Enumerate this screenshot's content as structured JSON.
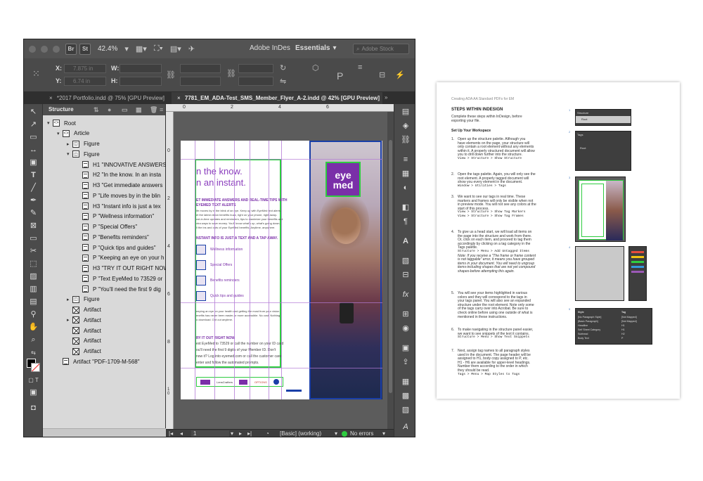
{
  "window": {
    "app_chips": [
      "Br",
      "St"
    ],
    "zoom": "42.4%",
    "app_name": "Adobe InDes",
    "workspace": "Essentials",
    "search_placeholder": "Adobe Stock"
  },
  "control": {
    "x_label": "X:",
    "x_value": "7.875 in",
    "y_label": "Y:",
    "y_value": "6.74 in",
    "w_label": "W:",
    "h_label": "H:"
  },
  "tabs": [
    {
      "label": "*2017 Portfolio.indd @ 75% [GPU Preview]"
    },
    {
      "label": "7781_EM_ADA-Test_SMS_Member_Flyer_A-2.indd @ 42% [GPU Preview]"
    }
  ],
  "structure": {
    "title": "Structure",
    "rows": [
      {
        "label": "Root"
      },
      {
        "label": "Article"
      },
      {
        "label": "Figure"
      },
      {
        "label": "Figure"
      },
      {
        "label": "H1  \"INNOVATIVE ANSWERS"
      },
      {
        "label": "H2  \"In the know. In an insta"
      },
      {
        "label": "H3  \"Get immediate answers"
      },
      {
        "label": "P  \"Life moves by in the blin"
      },
      {
        "label": "H3  \"Instant info is just a tex"
      },
      {
        "label": "P  \"Wellness information\""
      },
      {
        "label": "P  \"Special Offers\""
      },
      {
        "label": "P  \"Benefits reminders\""
      },
      {
        "label": "P  \"Quick tips and guides\""
      },
      {
        "label": "P  \"Keeping an eye on your h"
      },
      {
        "label": "H3  \"TRY IT OUT RIGHT NOW"
      },
      {
        "label": "P  \"Text EyeMed to 73529 or"
      },
      {
        "label": "P  \"You'll need the first 9 dig"
      },
      {
        "label": "Figure"
      },
      {
        "label": "Artifact"
      },
      {
        "label": "Artifact"
      },
      {
        "label": "Artifact"
      },
      {
        "label": "Artifact"
      },
      {
        "label": "Artifact"
      },
      {
        "label": "Artifact  \"PDF-1709-M-568\""
      }
    ]
  },
  "ruler": {
    "top": [
      "0",
      "2",
      "4",
      "6"
    ],
    "left": [
      "0",
      "2",
      "4",
      "6",
      "8",
      "1 0"
    ]
  },
  "flyer": {
    "headline_1": "n the know.",
    "headline_2": "n an instant.",
    "sub_1": "ET IMMEDIATE ANSWERS AND REAL-TIME TIPS WITH",
    "sub_1b": "EYEMED TEXT ALERTS",
    "body_1": "ife moves by in the blink of an eye. Keep up with EyeMed text alerts.",
    "body_2": "et the latest vision benefits buzz, right on your phone, right away-",
    "body_3": "ust-in-time updates and reminders, tips to maximize your benefits and",
    "body_4": "xtra ways to save money. You'll know what's up, what's going down,",
    "body_5": "ll the ins and outs of your EyeMed benefits. Anytime, anywhere.",
    "sub_2": "NSTANT INFO IS JUST A TEXT AND A TAP AWAY.",
    "links": [
      "Wellness information",
      "Special Offers",
      "Benefits reminders",
      "Quick tips and guides"
    ],
    "body_6": "eeping an eye on your health and getting the most from your vision",
    "body_7": "enefits has never been easier-or more accessible. No cost. Nothing",
    "body_8": "o download. Opt out anytime.",
    "sub_3": "RY IT OUT RIGHT NOW",
    "body_9": "ext EyeMed to 73529 or call the number on your ID card",
    "body_10": "ou'll need the first 9 digits of your Member ID. Don't",
    "body_11": "now it? Log into eyemed.com or call the customer care",
    "body_12": "enter and follow the automated prompts.",
    "logo_line1": "eye",
    "logo_line2": "med",
    "footer_logos": [
      "LensCrafters",
      "OPTIONS"
    ]
  },
  "status": {
    "page": "1",
    "style": "[Basic] (working)",
    "errors": "No errors"
  },
  "doc": {
    "header": "Creating ADA AA Standard PDFs for EM",
    "title": "STEPS WITHIN INDESIGN",
    "intro_1": "Complete these steps within InDesign, before",
    "intro_2": "exporting your file.",
    "setup": "Set Up Your Workspace",
    "steps": [
      {
        "n": "1.",
        "lines": [
          "Open up the structure palette. Although you",
          "have elements on the page, your structure will",
          "only contain a root element without any elements",
          "within it. A properly structured document will allow",
          "you to drill down further into the structure."
        ],
        "path": "View > Structure > Show Structure"
      },
      {
        "n": "2.",
        "lines": [
          "Open the tags palette. Again, you will only see the",
          "root element. A properly tagged document will",
          "show you every element in the document."
        ],
        "path": "Window > Utilities > Tags"
      },
      {
        "n": "3.",
        "lines": [
          "We want to see our tags in real time. These",
          "markers and frames will only be visible when not",
          "in preview mode. You will not see any colors at the",
          "start of this process."
        ],
        "path": "View > Structure > Show Tag Markers",
        "path2": "View > Structure > Show Tag Frames"
      },
      {
        "n": "4.",
        "lines": [
          "To give us a head start, we will load all items on",
          "the page into the structure and work from there.",
          "Or, click on each item, and proceed to tag them",
          "accordingly by clicking on a tag category in the",
          "Tags palette."
        ],
        "path": "Structure > Menu > Add Untagged Items",
        "note": [
          "Note: If you receive a \"The frame or frame content",
          "is not taggable\" error, it means you have grouped",
          "items in your document. You will need to ungroup",
          "items-including shapes that are not yet compound",
          "shapes-before attempting this again."
        ]
      },
      {
        "n": "5.",
        "lines": [
          "You will see your items highlighted in various",
          "colors and they will correspond to the tags in",
          "your tags panel. You will also see an expanded",
          "structure under the root element. Note only some",
          "of the tags carry over into Acrobat. Be sure to",
          "check online before using one outside of what is",
          "mentioned in these instructions."
        ]
      },
      {
        "n": "6.",
        "lines": [
          "To make navigating in the structure panel easier,",
          "we want to see snippets of the text it contains."
        ],
        "path": "Structure > Menu > Show Text Snippets"
      },
      {
        "n": "7.",
        "lines": [
          "Next, assign tag names to all paragraph styles",
          "used in the document. The page header will be",
          "assigned to H1, body copy assigned to P, etc.",
          "H1 - H6 are available for upper-level headings.",
          "Number them according to the order in which",
          "they should be read."
        ],
        "path": "Tags > Menu > Map Styles to Tags"
      }
    ],
    "thumb_nums": [
      "1",
      "2",
      "3",
      "4",
      "5",
      "6"
    ],
    "thumb1_title": "Structure",
    "thumb1_row": "Root",
    "thumb2_title": "Tags",
    "thumb2_row": "Root",
    "thumb5_rows": [
      {
        "style": "[No Paragraph Style]",
        "tag": "[Not Mapped]"
      },
      {
        "style": "[Basic Paragraph]",
        "tag": "[Not Mapped]"
      },
      {
        "style": "Headline",
        "tag": "H1"
      },
      {
        "style": "Self Sheet Category",
        "tag": "H1"
      },
      {
        "style": "Subhead",
        "tag": "H2"
      },
      {
        "style": "Body Text",
        "tag": "P"
      }
    ],
    "thumb5_col_style": "Style",
    "thumb5_col_tag": "Tag"
  }
}
